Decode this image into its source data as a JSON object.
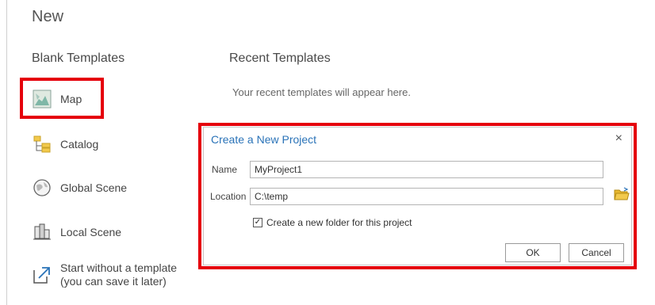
{
  "page": {
    "title": "New"
  },
  "blank_templates": {
    "heading": "Blank Templates",
    "items": [
      {
        "label": "Map",
        "icon": "map-icon"
      },
      {
        "label": "Catalog",
        "icon": "catalog-icon"
      },
      {
        "label": "Global Scene",
        "icon": "globe-icon"
      },
      {
        "label": "Local Scene",
        "icon": "local-scene-icon"
      },
      {
        "label_line1": "Start without a template",
        "label_line2": "(you can save it later)",
        "icon": "start-arrow-icon"
      }
    ]
  },
  "recent_templates": {
    "heading": "Recent Templates",
    "empty_message": "Your recent templates will appear here."
  },
  "dialog": {
    "title": "Create a New Project",
    "close_glyph": "×",
    "name_label": "Name",
    "name_value": "MyProject1",
    "location_label": "Location",
    "location_value": "C:\\temp",
    "create_folder_label": "Create a new folder for this project",
    "create_folder_checked": true,
    "ok_label": "OK",
    "cancel_label": "Cancel"
  },
  "colors": {
    "highlight": "#e5000b",
    "dialog_title": "#2a73b8",
    "folder_icon": "#f2c94c"
  }
}
